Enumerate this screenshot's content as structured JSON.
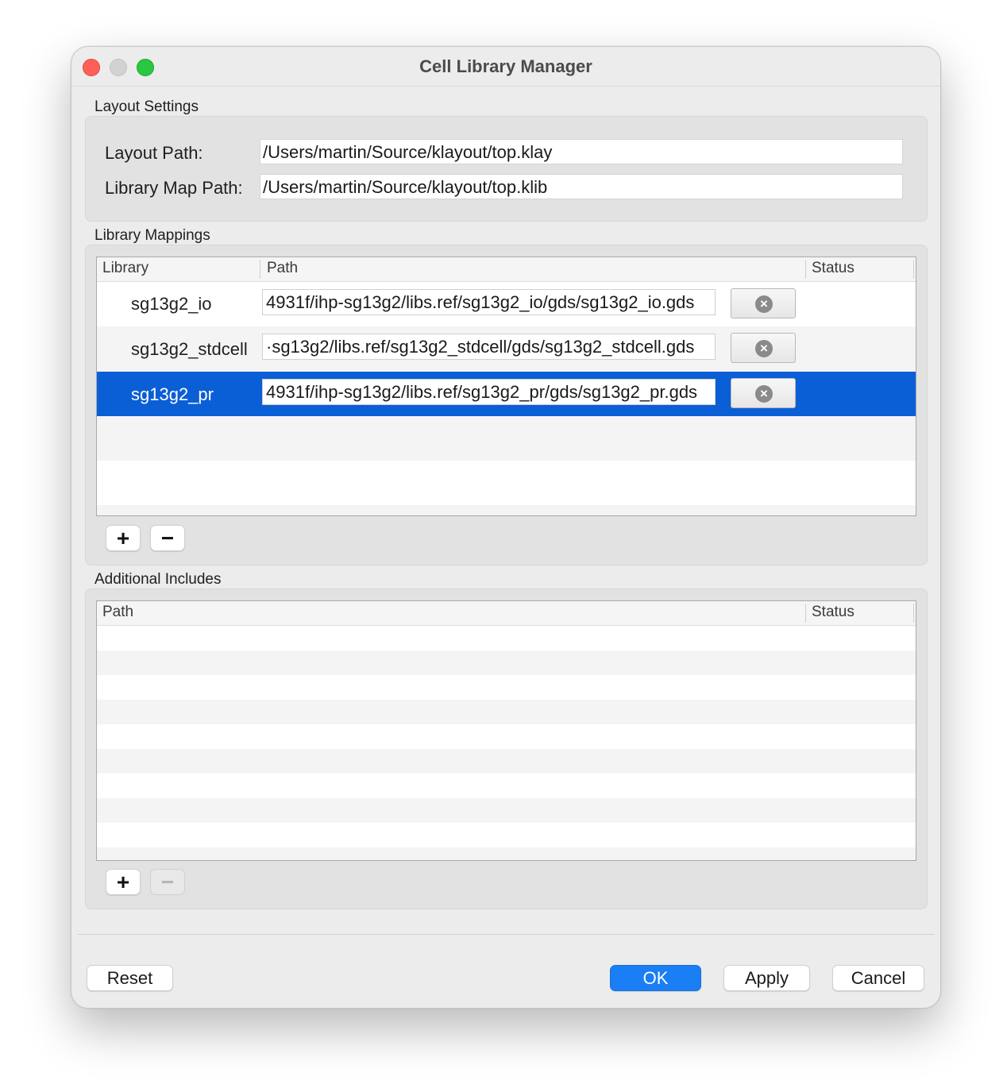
{
  "window": {
    "title": "Cell Library Manager"
  },
  "layout_settings": {
    "section_label": "Layout Settings",
    "layout_path_label": "Layout Path:",
    "layout_path_value": "/Users/martin/Source/klayout/top.klay",
    "library_map_path_label": "Library Map Path:",
    "library_map_path_value": "/Users/martin/Source/klayout/top.klib"
  },
  "library_mappings": {
    "section_label": "Library Mappings",
    "columns": {
      "library": "Library",
      "path": "Path",
      "status": "Status"
    },
    "rows": [
      {
        "library": "sg13g2_io",
        "path": "4931f/ihp-sg13g2/libs.ref/sg13g2_io/gds/sg13g2_io.gds",
        "selected": false
      },
      {
        "library": "sg13g2_stdcell",
        "path": "·sg13g2/libs.ref/sg13g2_stdcell/gds/sg13g2_stdcell.gds",
        "selected": false
      },
      {
        "library": "sg13g2_pr",
        "path": "4931f/ihp-sg13g2/libs.ref/sg13g2_pr/gds/sg13g2_pr.gds",
        "selected": true
      }
    ],
    "add_icon": "plus-icon",
    "remove_icon": "minus-icon"
  },
  "additional_includes": {
    "section_label": "Additional Includes",
    "columns": {
      "path": "Path",
      "status": "Status"
    },
    "rows": [],
    "add_icon": "plus-icon",
    "remove_icon": "minus-icon",
    "remove_enabled": false
  },
  "buttons": {
    "reset": "Reset",
    "ok": "OK",
    "apply": "Apply",
    "cancel": "Cancel"
  },
  "colors": {
    "selection": "#0a5fd7",
    "primary_button": "#1a7ef5",
    "close": "#fe5f57",
    "minimize_inactive": "#d2d2d2",
    "maximize": "#28c840"
  }
}
